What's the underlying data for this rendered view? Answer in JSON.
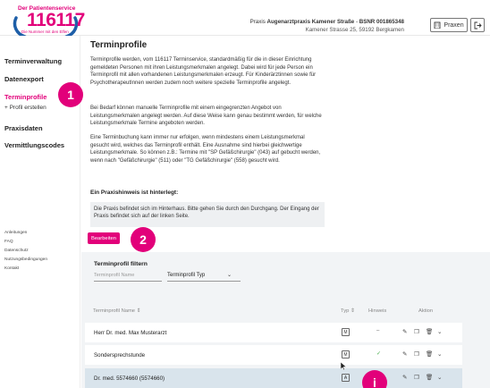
{
  "header": {
    "logo_tagline": "Der Patientenservice",
    "logo_number": "116117",
    "logo_subline": "Die Nummer mit den Elfen",
    "practice_prefix": "Praxis",
    "practice_name": "Augenarztpraxis Kamener Straße",
    "bsnr_label": "BSNR",
    "bsnr": "001865348",
    "address": "Kamener Strasse 25, 59192 Bergkamen",
    "praxen_label": "Praxen"
  },
  "sidebar": {
    "items": [
      {
        "label": "Terminverwaltung"
      },
      {
        "label": "Datenexport"
      },
      {
        "label": "Terminprofile"
      },
      {
        "label": "+ Profil erstellen"
      },
      {
        "label": "Praxisdaten"
      },
      {
        "label": "Vermittlungscodes"
      }
    ],
    "footer": [
      "Anleitungen",
      "FAQ",
      "Datenschutz",
      "Nutzungsbedingungen",
      "Kontakt"
    ]
  },
  "markers": {
    "m1": "1",
    "m2": "2",
    "mi": "i"
  },
  "main": {
    "title": "Terminprofile",
    "para1": "Terminprofile werden, vom 116117 Terminservice, standardmäßig für die in dieser Einrichtung gemeldeten Personen mit ihren Leistungsmerkmalen angelegt. Dabei wird für jede Person ein Terminprofil mit allen vorhandenen Leistungsmerkmalen erzeugt. Für Kinderärztinnen sowie für PsychotherapeutInnen werden zudem noch weitere spezielle Terminprofile angelegt.",
    "para2": "Bei Bedarf können manuelle Terminprofile mit einem eingegrenzten Angebot von Leistungsmerkmalen angelegt werden. Auf diese Weise kann genau bestimmt werden, für welche Leistungsmerkmale Termine angeboten werden.",
    "para3": "Eine Terminbuchung kann immer nur erfolgen, wenn mindestens einem Leistungsmerkmal gesucht wird, welches das Terminprofil enthält. Eine Ausnahme sind hierbei gleichwertige Leistungsmerkmale. So können z.B.: Termine mit \"SP Gefäßchirurgie\" (043) auf gebucht werden, wenn nach \"Gefäßchirurgie\" (511) oder \"TG Gefäßchirurgie\" (558) gesucht wird.",
    "hint_title": "Ein Praxishinweis ist hinterlegt:",
    "hint_text": "Die Praxis befindet sich im Hinterhaus. Bitte gehen Sie durch den Durchgang. Der Eingang der Praxis befindet sich auf der linken Seite.",
    "edit_label": "Bearbeiten"
  },
  "filter": {
    "title": "Terminprofil filtern",
    "name_placeholder": "Terminprofil Name",
    "type_label": "Terminprofil Typ"
  },
  "table": {
    "headers": {
      "name": "Terminprofil Name",
      "typ": "Typ",
      "hinweis": "Hinweis",
      "aktion": "Aktion"
    },
    "rows": [
      {
        "name": "Herr Dr. med. Max Musterarzt",
        "typ": "M",
        "hinweis": "–"
      },
      {
        "name": "Sondersprechstunde",
        "typ": "M",
        "hinweis": "✓"
      },
      {
        "name": "Dr. med. 5574660 (5574660)",
        "typ": "A",
        "hinweis": ""
      }
    ]
  },
  "colors": {
    "accent": "#e2007a",
    "selected_row": "#d9e4ec",
    "panel_bg": "#f2f4f6"
  }
}
